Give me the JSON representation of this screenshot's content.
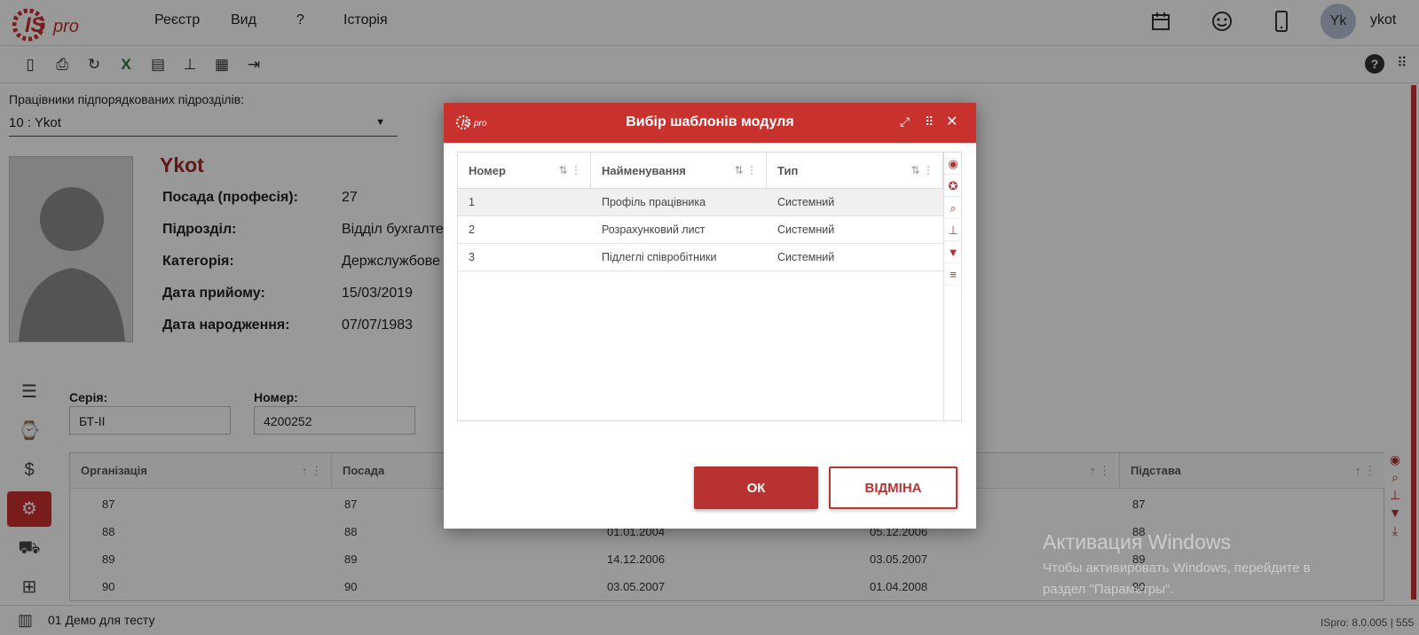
{
  "app": {
    "logo": "ISpro"
  },
  "menu": [
    "Реєстр",
    "Вид",
    "?",
    "Історія"
  ],
  "user": {
    "initials": "Yk",
    "name": "ykot"
  },
  "subdivision": {
    "label": "Працівники підпорядкованих підрозділів:",
    "value": "10 : Ykot"
  },
  "profile": {
    "name": "Ykot",
    "fields": [
      {
        "label": "Посада (професія):",
        "value": "27"
      },
      {
        "label": "Підрозділ:",
        "value": "Відділ бухгалте"
      },
      {
        "label": "Категорія:",
        "value": "Держслужбове"
      },
      {
        "label": "Дата прийому:",
        "value": "15/03/2019"
      },
      {
        "label": "Дата народження:",
        "value": "07/07/1983"
      }
    ]
  },
  "document": {
    "series_label": "Серія:",
    "series": "БТ-ІІ",
    "number_label": "Номер:",
    "number": "4200252"
  },
  "bg_grid": {
    "headers": [
      "Організація",
      "Посада",
      "Підстава"
    ],
    "rows": [
      [
        "87",
        "87",
        "",
        "",
        "87"
      ],
      [
        "88",
        "88",
        "01.01.2004",
        "05.12.2006",
        "88"
      ],
      [
        "89",
        "89",
        "14.12.2006",
        "03.05.2007",
        "89"
      ],
      [
        "90",
        "90",
        "03.05.2007",
        "01.04.2008",
        "90"
      ]
    ]
  },
  "status": {
    "org": "01 Демо для тесту",
    "version": "ISpro: 8.0.005 | 555"
  },
  "watermark": {
    "title": "Активация Windows",
    "line1": "Чтобы активировать Windows, перейдите в",
    "line2": "раздел \"Параметры\"."
  },
  "dialog": {
    "logo": "ISpro",
    "title": "Вибір шаблонів модуля",
    "columns": [
      "Номер",
      "Найменування",
      "Тип"
    ],
    "rows": [
      {
        "num": "1",
        "name": "Профіль працівника",
        "type": "Системний"
      },
      {
        "num": "2",
        "name": "Розрахунковий лист",
        "type": "Системний"
      },
      {
        "num": "3",
        "name": "Підлеглі співробітники",
        "type": "Системний"
      }
    ],
    "ok": "ОК",
    "cancel": "ВІДМІНА"
  },
  "colors": {
    "brand": "#c9312f",
    "accent_dark": "#b83231",
    "name_color": "#9d2a2a"
  }
}
